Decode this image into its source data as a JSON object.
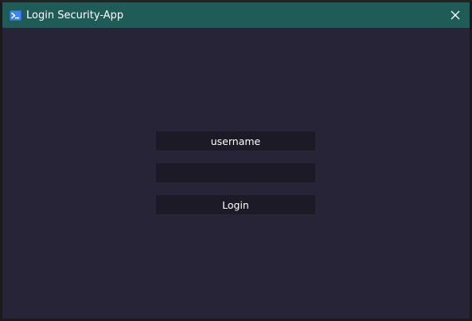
{
  "window": {
    "title": "Login Security-App",
    "titlebar_color": "#1f5b57",
    "background_color": "#262436",
    "app_icon": "powershell-icon",
    "close_icon": "close-icon"
  },
  "form": {
    "username": {
      "value": "username",
      "placeholder": ""
    },
    "password": {
      "value": "",
      "placeholder": ""
    },
    "login_label": "Login",
    "field_color": "#1c1a26"
  }
}
